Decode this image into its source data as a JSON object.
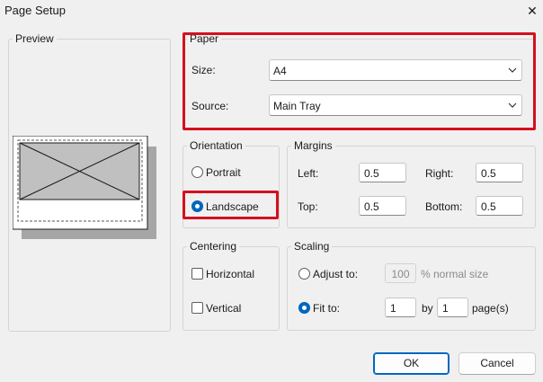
{
  "window": {
    "title": "Page Setup",
    "close_glyph": "✕"
  },
  "preview": {
    "legend": "Preview"
  },
  "paper": {
    "legend": "Paper",
    "size_label": "Size:",
    "size_value": "A4",
    "source_label": "Source:",
    "source_value": "Main Tray"
  },
  "orientation": {
    "legend": "Orientation",
    "portrait_label": "Portrait",
    "landscape_label": "Landscape",
    "selected": "Landscape"
  },
  "margins": {
    "legend": "Margins",
    "left_label": "Left:",
    "left_value": "0.5",
    "right_label": "Right:",
    "right_value": "0.5",
    "top_label": "Top:",
    "top_value": "0.5",
    "bottom_label": "Bottom:",
    "bottom_value": "0.5"
  },
  "centering": {
    "legend": "Centering",
    "horizontal_label": "Horizontal",
    "horizontal_checked": false,
    "vertical_label": "Vertical",
    "vertical_checked": false
  },
  "scaling": {
    "legend": "Scaling",
    "adjust_label": "Adjust to:",
    "adjust_value": "100",
    "adjust_suffix": "% normal size",
    "fit_label": "Fit to:",
    "fit_wide_value": "1",
    "by_label": "by",
    "fit_tall_value": "1",
    "pages_suffix": "page(s)",
    "selected": "Fit to"
  },
  "buttons": {
    "ok_label": "OK",
    "cancel_label": "Cancel"
  },
  "colors": {
    "dialog_background": "#f0f0f0",
    "accent": "#0067c0",
    "highlight_red": "#d4101e",
    "preview_page_fill": "#c0c0c0",
    "preview_shadow": "#a6a6a6"
  },
  "icons": {
    "close": "close-icon",
    "dropdown": "chevron-down-icon"
  }
}
